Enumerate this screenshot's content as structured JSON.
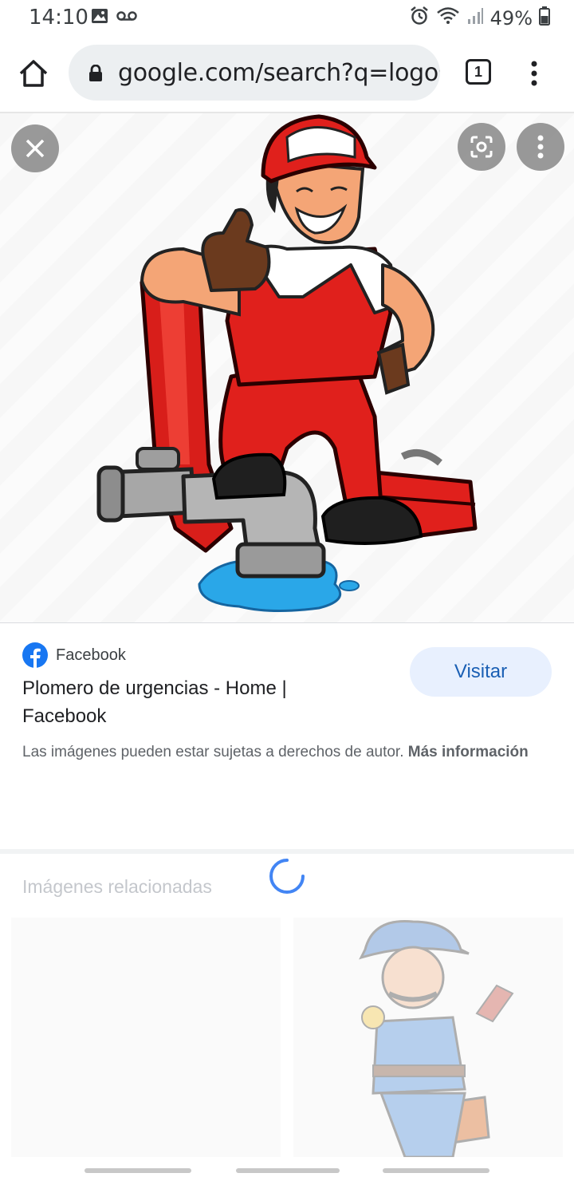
{
  "status_bar": {
    "time": "14:10",
    "battery": "49%",
    "icons": [
      "image-icon",
      "voicemail-icon",
      "alarm-icon",
      "wifi-icon",
      "signal-icon",
      "battery-icon"
    ]
  },
  "browser": {
    "url": "google.com/search?q=logos",
    "tab_count": "1",
    "icons": [
      "home-icon",
      "lock-icon",
      "tabs-icon",
      "menu-icon"
    ]
  },
  "viewer": {
    "image_alt": "Plumber cartoon with pipe wrench and toolbox",
    "icons": [
      "close-icon",
      "lens-icon",
      "more-icon"
    ]
  },
  "result": {
    "source": "Facebook",
    "title": "Plomero de urgencias - Home | Facebook",
    "visit_label": "Visitar",
    "copyright_text": "Las imágenes pueden estar sujetas a derechos de autor.",
    "more_info_label": "Más información"
  },
  "related": {
    "heading": "Imágenes relacionadas"
  },
  "colors": {
    "accent_blue": "#1a73e8",
    "visit_bg": "#e8f0fe",
    "overall_red": "#e0201c",
    "facebook_blue": "#1877f2"
  }
}
